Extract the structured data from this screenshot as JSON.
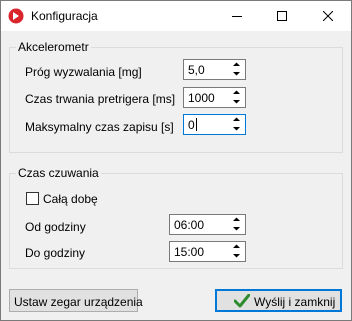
{
  "window": {
    "title": "Konfiguracja",
    "icon": "app-logo-icon",
    "controls": [
      "minimize-icon",
      "maximize-icon",
      "close-icon"
    ]
  },
  "accelerometer": {
    "group_label": "Akcelerometr",
    "threshold": {
      "label": "Próg wyzwalania [mg]",
      "value": "5,0"
    },
    "pretrigger": {
      "label": "Czas trwania pretrigera [ms]",
      "value": "1000"
    },
    "max_record": {
      "label": "Maksymalny czas zapisu [s]",
      "value": "0"
    }
  },
  "standby": {
    "group_label": "Czas czuwania",
    "all_day": {
      "label": "Całą dobę",
      "checked": false
    },
    "from": {
      "label": "Od godziny",
      "value": "06:00"
    },
    "to": {
      "label": "Do godziny",
      "value": "15:00"
    }
  },
  "buttons": {
    "set_clock": "Ustaw zegar urządzenia",
    "send_close": "Wyślij i zamknij"
  },
  "colors": {
    "accent": "#0078d7",
    "logo": "#d9262b",
    "check": "#2e8b2e"
  }
}
